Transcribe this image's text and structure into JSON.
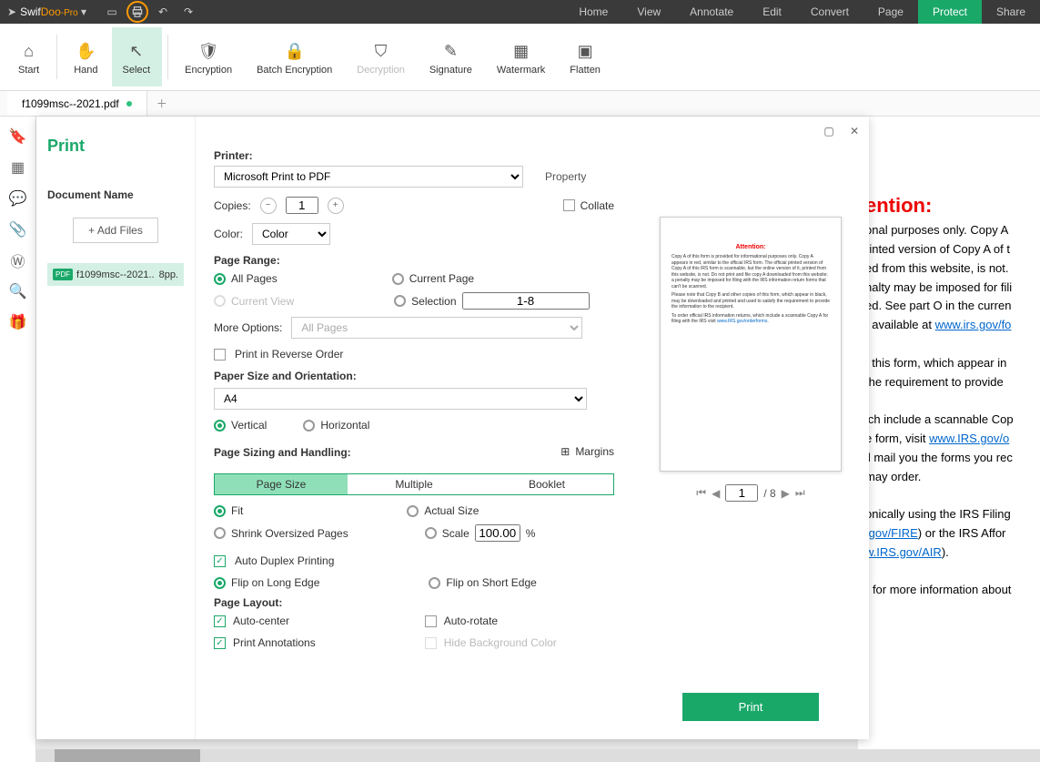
{
  "app": {
    "name1": "Swif",
    "name2": "Doo",
    "suffix": "-Pro"
  },
  "menu": {
    "home": "Home",
    "view": "View",
    "annotate": "Annotate",
    "edit": "Edit",
    "convert": "Convert",
    "page": "Page",
    "protect": "Protect",
    "share": "Share"
  },
  "ribbon": {
    "start": "Start",
    "hand": "Hand",
    "select": "Select",
    "encryption": "Encryption",
    "batch": "Batch Encryption",
    "decryption": "Decryption",
    "signature": "Signature",
    "watermark": "Watermark",
    "flatten": "Flatten"
  },
  "tab": {
    "name": "f1099msc--2021.pdf"
  },
  "dialog": {
    "title": "Print",
    "docname_label": "Document Name",
    "add_files": "+   Add Files",
    "file_name": "f1099msc--2021..",
    "file_pages": "8pp.",
    "printer_label": "Printer:",
    "printer_value": "Microsoft Print to PDF",
    "property": "Property",
    "copies_label": "Copies:",
    "copies_value": "1",
    "collate": "Collate",
    "color_label": "Color:",
    "color_value": "Color",
    "page_range": "Page Range:",
    "all_pages": "All Pages",
    "current_page": "Current Page",
    "current_view": "Current View",
    "selection": "Selection",
    "selection_value": "1-8",
    "more_options": "More Options:",
    "more_options_value": "All Pages",
    "reverse": "Print in Reverse Order",
    "paper_label": "Paper Size and Orientation:",
    "paper_value": "A4",
    "vertical": "Vertical",
    "horizontal": "Horizontal",
    "sizing_label": "Page Sizing and Handling:",
    "margins": "Margins",
    "seg_page_size": "Page Size",
    "seg_multiple": "Multiple",
    "seg_booklet": "Booklet",
    "fit": "Fit",
    "actual": "Actual Size",
    "shrink": "Shrink Oversized Pages",
    "scale": "Scale",
    "scale_value": "100.00",
    "percent": "%",
    "duplex": "Auto Duplex Printing",
    "flip_long": "Flip on Long Edge",
    "flip_short": "Flip on Short Edge",
    "layout_label": "Page Layout:",
    "auto_center": "Auto-center",
    "auto_rotate": "Auto-rotate",
    "print_anno": "Print Annotations",
    "hide_bg": "Hide Background Color",
    "preview_page": "1",
    "preview_total": "/ 8",
    "print_button": "Print"
  },
  "bgdoc": {
    "attention": "ention:",
    "l1": "onal purposes only. Copy A",
    "l2": "rinted version of Copy A of t",
    "l3": "ed from this website, is not.",
    "l4": "nalty may be imposed for fili",
    "l5": "ed. See part O in the curren",
    "l6": ", available at ",
    "link1": "www.irs.gov/fo",
    "l7": "f this form, which appear in",
    "l8": " the requirement to provide",
    "l9": "ich include a scannable Cop",
    "l10": "e form, visit ",
    "link2": "www.IRS.gov/o",
    "l11": "ll mail you the forms you rec",
    "l12": " may order.",
    "l13": "onically using the IRS Filing",
    "link3": ".gov/FIRE",
    "l14": ") or the IRS Affor",
    "link4": "w.IRS.gov/AIR",
    "l15": ").",
    "l16": ") for more information about"
  },
  "preview": {
    "attention": "Attention:"
  }
}
